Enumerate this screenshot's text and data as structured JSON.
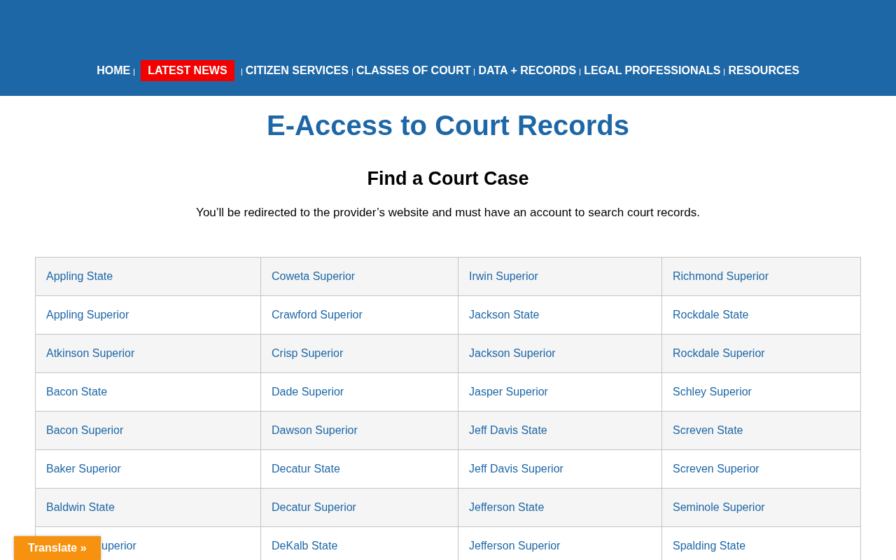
{
  "nav": [
    {
      "label": "HOME",
      "selected": false
    },
    {
      "label": "LATEST NEWS",
      "selected": true
    },
    {
      "label": "CITIZEN SERVICES",
      "selected": false
    },
    {
      "label": "CLASSES OF COURT",
      "selected": false
    },
    {
      "label": "DATA + RECORDS",
      "selected": false
    },
    {
      "label": "LEGAL PROFESSIONALS",
      "selected": false
    },
    {
      "label": "RESOURCES",
      "selected": false
    }
  ],
  "title": "E-Access to Court Records",
  "heading": "Find a Court Case",
  "intro": "You’ll be redirected to the provider’s website and must have an account to search court records.",
  "table": {
    "rows": [
      [
        {
          "text": "Appling State",
          "kind": "link"
        },
        {
          "text": "Coweta Superior",
          "kind": "link"
        },
        {
          "text": "Irwin Superior",
          "kind": "link"
        },
        {
          "text": "Richmond Superior",
          "kind": "link"
        }
      ],
      [
        {
          "text": "Appling Superior",
          "kind": "link"
        },
        {
          "text": "Crawford Superior",
          "kind": "link"
        },
        {
          "text": "Jackson State",
          "kind": "link"
        },
        {
          "text": "Rockdale State",
          "kind": "link"
        }
      ],
      [
        {
          "text": "Atkinson Superior",
          "kind": "link"
        },
        {
          "text": "Crisp Superior",
          "kind": "link"
        },
        {
          "text": "Jackson Superior",
          "kind": "link"
        },
        {
          "text": "Rockdale Superior",
          "kind": "link"
        }
      ],
      [
        {
          "text": "Bacon State",
          "kind": "link"
        },
        {
          "text": "Dade Superior",
          "kind": "link"
        },
        {
          "text": "Jasper Superior",
          "kind": "link"
        },
        {
          "text": "Schley Superior",
          "kind": "link"
        }
      ],
      [
        {
          "text": "Bacon Superior",
          "kind": "link"
        },
        {
          "text": "Dawson Superior",
          "kind": "link"
        },
        {
          "text": "Jeff Davis State",
          "kind": "link"
        },
        {
          "text": "Screven State",
          "kind": "link"
        }
      ],
      [
        {
          "text": "Baker Superior",
          "kind": "link"
        },
        {
          "text": "Decatur State",
          "kind": "link"
        },
        {
          "text": "Jeff Davis Superior",
          "kind": "link"
        },
        {
          "text": "Screven Superior",
          "kind": "link"
        }
      ],
      [
        {
          "text": "Baldwin State",
          "kind": "link"
        },
        {
          "text": "Decatur Superior",
          "kind": "link"
        },
        {
          "text": "Jefferson State",
          "kind": "link"
        },
        {
          "text": "Seminole Superior",
          "kind": "link"
        }
      ],
      [
        {
          "text": "uperior",
          "kind": "covered"
        },
        {
          "text": "DeKalb State",
          "kind": "link"
        },
        {
          "text": "Jefferson Superior",
          "kind": "link"
        },
        {
          "text": "Spalding State",
          "kind": "link"
        }
      ]
    ]
  },
  "translate_button": "Translate »"
}
